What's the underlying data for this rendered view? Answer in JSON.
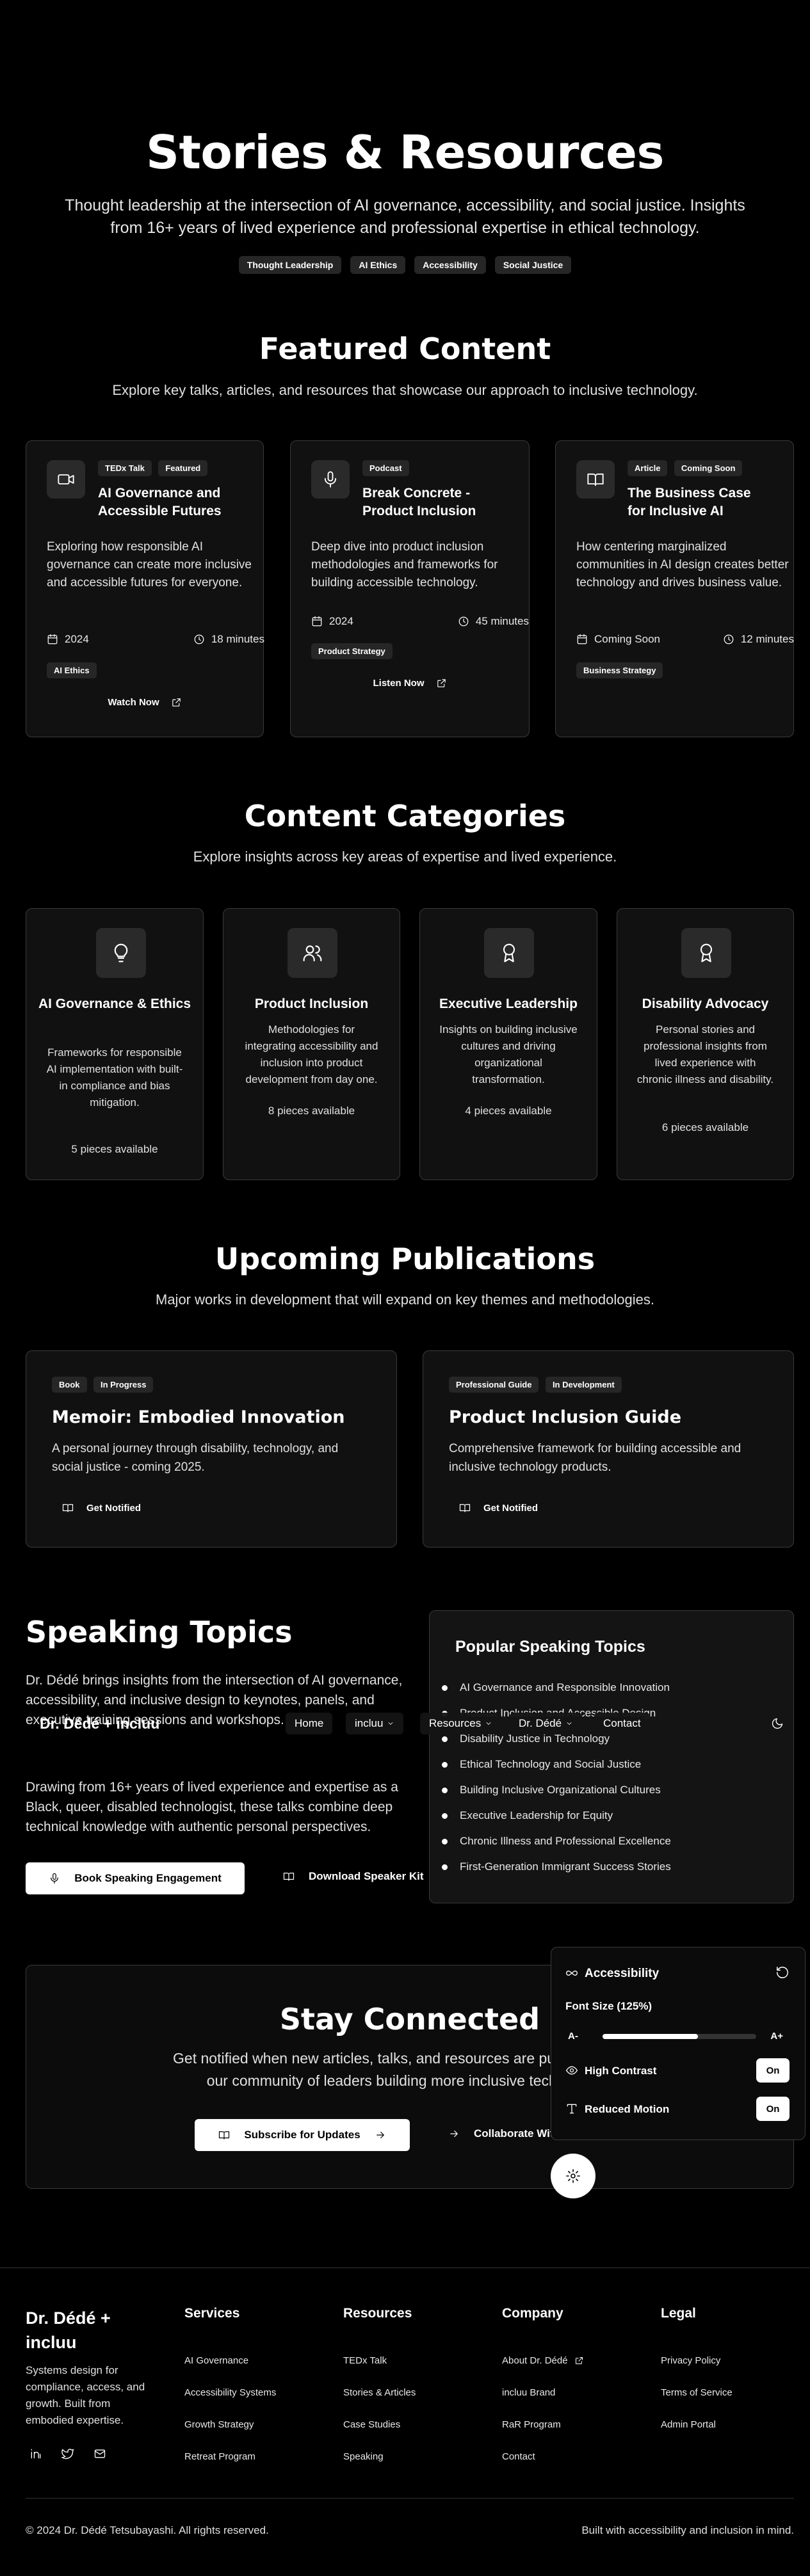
{
  "hero": {
    "title": "Stories & Resources",
    "subtitle": "Thought leadership at the intersection of AI governance, accessibility, and social justice. Insights from 16+ years of lived experience and professional expertise in ethical technology.",
    "pills": [
      "Thought Leadership",
      "AI Ethics",
      "Accessibility",
      "Social Justice"
    ]
  },
  "featured": {
    "title": "Featured Content",
    "subtitle": "Explore key talks, articles, and resources that showcase our approach to inclusive technology.",
    "cards": [
      {
        "icon": "video-icon",
        "tags": [
          "TEDx Talk",
          "Featured"
        ],
        "title": "AI Governance and Accessible Futures",
        "desc": "Exploring how responsible AI governance can create more inclusive and accessible futures for everyone.",
        "date": "2024",
        "duration": "18 minutes",
        "chip": "AI Ethics",
        "action": "Watch Now"
      },
      {
        "icon": "microphone-icon",
        "tags": [
          "Podcast"
        ],
        "title": "Break Concrete - Product Inclusion",
        "desc": "Deep dive into product inclusion methodologies and frameworks for building accessible technology.",
        "date": "2024",
        "duration": "45 minutes",
        "chip": "Product Strategy",
        "action": "Listen Now"
      },
      {
        "icon": "book-icon",
        "tags": [
          "Article",
          "Coming Soon"
        ],
        "title": "The Business Case for Inclusive AI",
        "desc": "How centering marginalized communities in AI design creates better technology and drives business value.",
        "date": "Coming Soon",
        "duration": "12 minutes",
        "chip": "Business Strategy",
        "action": ""
      }
    ]
  },
  "categories": {
    "title": "Content Categories",
    "subtitle": "Explore insights across key areas of expertise and lived experience.",
    "cards": [
      {
        "icon": "lightbulb-icon",
        "title": "AI Governance & Ethics",
        "desc": "Frameworks for responsible AI implementation with built-in compliance and bias mitigation.",
        "count": "5 pieces available"
      },
      {
        "icon": "users-icon",
        "title": "Product Inclusion",
        "desc": "Methodologies for integrating accessibility and inclusion into product development from day one.",
        "count": "8 pieces available"
      },
      {
        "icon": "award-icon",
        "title": "Executive Leadership",
        "desc": "Insights on building inclusive cultures and driving organizational transformation.",
        "count": "4 pieces available"
      },
      {
        "icon": "award-icon",
        "title": "Disability Advocacy",
        "desc": "Personal stories and professional insights from lived experience with chronic illness and disability.",
        "count": "6 pieces available"
      }
    ]
  },
  "publications": {
    "title": "Upcoming Publications",
    "subtitle": "Major works in development that will expand on key themes and methodologies.",
    "cards": [
      {
        "tags": [
          "Book",
          "In Progress"
        ],
        "title": "Memoir: Embodied Innovation",
        "desc": "A personal journey through disability, technology, and social justice - coming 2025.",
        "action": "Get Notified"
      },
      {
        "tags": [
          "Professional Guide",
          "In Development"
        ],
        "title": "Product Inclusion Guide",
        "desc": "Comprehensive framework for building accessible and inclusive technology products.",
        "action": "Get Notified"
      }
    ]
  },
  "speaking": {
    "title": "Speaking Topics",
    "para1": "Dr. Dédé brings insights from the intersection of AI governance, accessibility, and inclusive design to keynotes, panels, and executive training sessions and workshops.",
    "para2": "Drawing from 16+ years of lived experience and expertise as a Black, queer, disabled technologist, these talks combine deep technical knowledge with authentic personal perspectives.",
    "btn_book": "Book Speaking Engagement",
    "btn_kit": "Download Speaker Kit",
    "panel_title": "Popular Speaking Topics",
    "topics": [
      "AI Governance and Responsible Innovation",
      "Product Inclusion and Accessible Design",
      "Disability Justice in Technology",
      "Ethical Technology and Social Justice",
      "Building Inclusive Organizational Cultures",
      "Executive Leadership for Equity",
      "Chronic Illness and Professional Excellence",
      "First-Generation Immigrant Success Stories"
    ]
  },
  "nav": {
    "brand": "Dr. Dédé + incluu",
    "items": [
      "Home",
      "incluu",
      "Resources",
      "Dr. Dédé",
      "Contact"
    ]
  },
  "connect": {
    "title": "Stay Connected",
    "desc": "Get notified when new articles, talks, and resources are published. Join our community of leaders building more inclusive technology.",
    "btn_subscribe": "Subscribe for Updates",
    "btn_collab": "Collaborate With Us"
  },
  "a11y": {
    "title": "Accessibility",
    "font_label": "Font Size (125%)",
    "font_min": "A-",
    "font_max": "A+",
    "font_level": 0.62,
    "contrast_label": "High Contrast",
    "contrast_state": "On",
    "motion_label": "Reduced Motion",
    "motion_state": "On"
  },
  "footer": {
    "brand": "Dr. Dédé + incluu",
    "tagline": "Systems design for compliance, access, and growth. Built from embodied expertise.",
    "columns": [
      {
        "title": "Services",
        "links": [
          "AI Governance",
          "Accessibility Systems",
          "Growth Strategy",
          "Retreat Program"
        ]
      },
      {
        "title": "Resources",
        "links": [
          "TEDx Talk",
          "Stories & Articles",
          "Case Studies",
          "Speaking"
        ]
      },
      {
        "title": "Company",
        "links": [
          "About Dr. Dédé",
          "incluu Brand",
          "RaR Program",
          "Contact"
        ]
      },
      {
        "title": "Legal",
        "links": [
          "Privacy Policy",
          "Terms of Service",
          "Admin Portal"
        ]
      }
    ],
    "copyright": "© 2024 Dr. Dédé Tetsubayashi. All rights reserved.",
    "builtwith": "Built with accessibility and inclusion in mind."
  }
}
